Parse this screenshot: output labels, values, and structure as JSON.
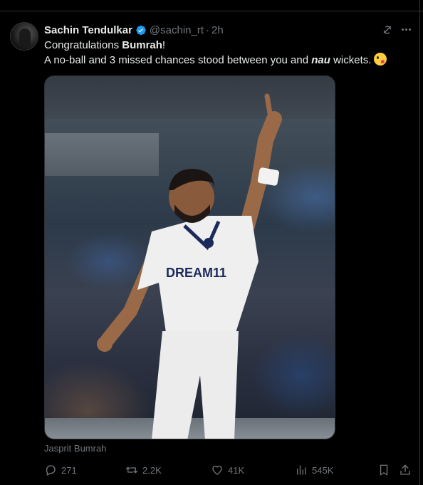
{
  "tweet": {
    "author_name": "Sachin Tendulkar",
    "handle": "@sachin_rt",
    "separator": "·",
    "time": "2h",
    "text": {
      "line1_prefix": "Congratulations ",
      "line1_bold": "Bumrah",
      "line1_suffix": "!",
      "line2_prefix": "A no-ball and 3 missed chances stood between you and ",
      "line2_italic": "nau",
      "line2_suffix": " wickets."
    },
    "jersey_text": "DREAM11",
    "photo_caption": "Jasprit Bumrah"
  },
  "actions": {
    "replies": "271",
    "reposts": "2.2K",
    "likes": "41K",
    "views": "545K"
  },
  "colors": {
    "background": "#000000",
    "text": "#e7e9ea",
    "muted": "#71767b",
    "verified": "#1d9bf0",
    "divider": "#2f3336"
  },
  "icons": [
    "verified-badge-icon",
    "grok-icon",
    "more-icon",
    "reply-icon",
    "repost-icon",
    "like-icon",
    "views-icon",
    "bookmark-icon",
    "share-icon",
    "emoji-zany-face-icon"
  ]
}
